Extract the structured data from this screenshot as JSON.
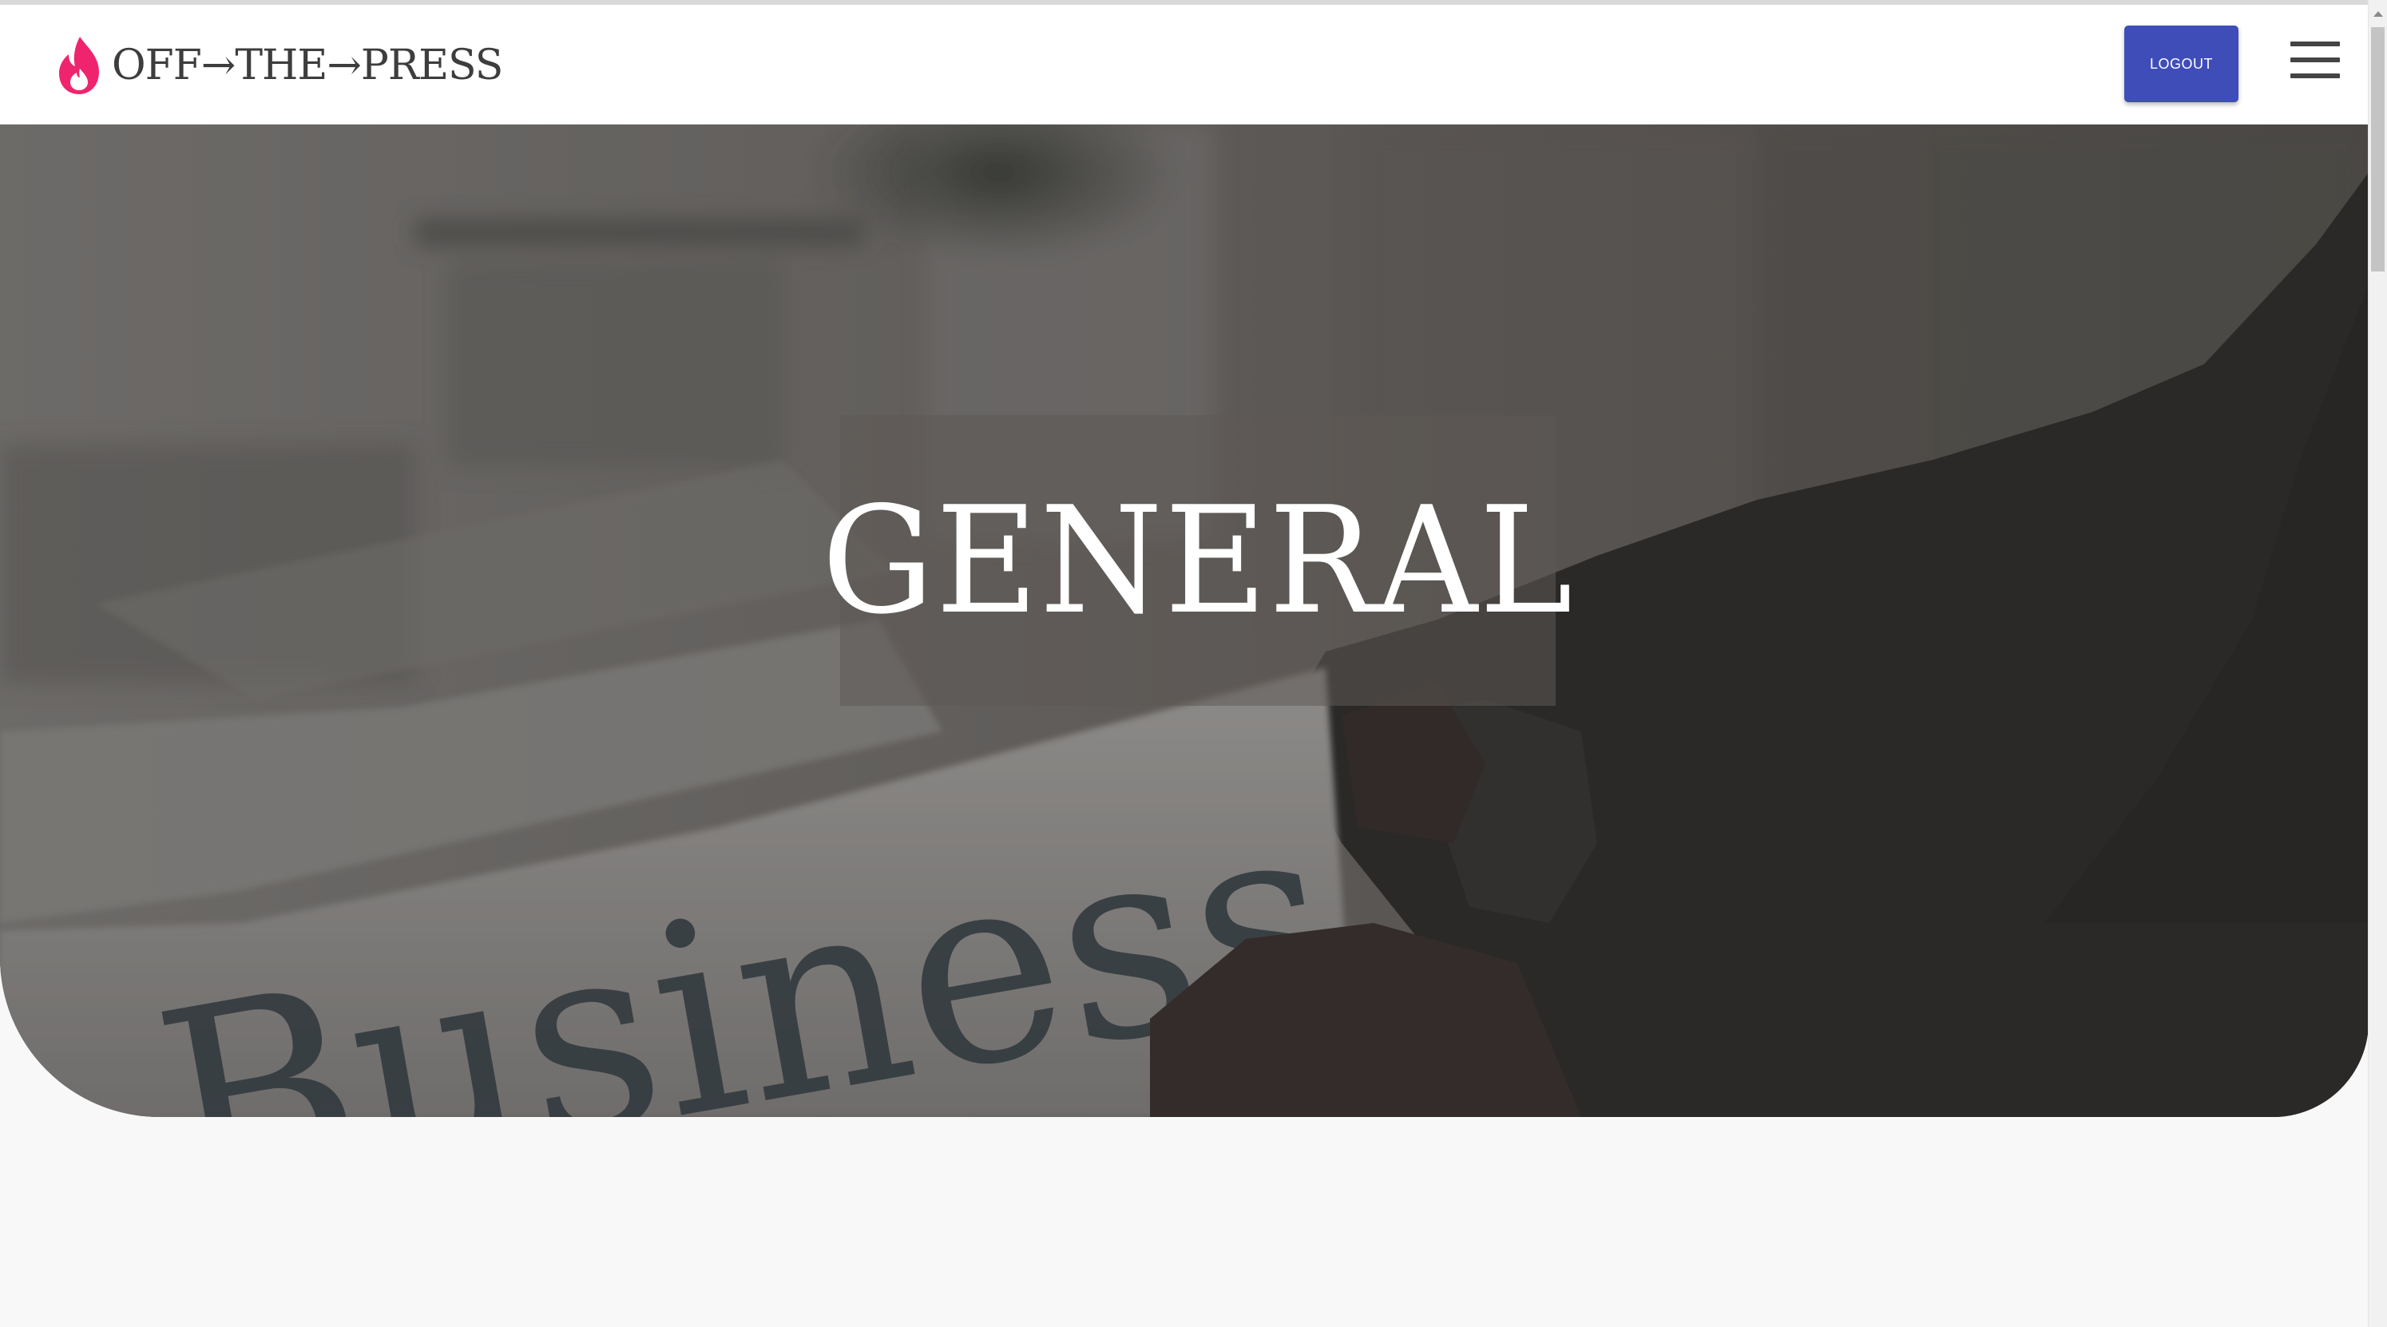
{
  "header": {
    "logo_text": "OFF→THE→PRESS",
    "logout_label": "LOGOUT",
    "logo_icon": "flame-icon",
    "menu_icon": "hamburger-menu-icon"
  },
  "hero": {
    "title": "GENERAL",
    "background_image": "newspaper-business-photo",
    "newspaper_headline": "Business"
  },
  "colors": {
    "brand_accent": "#f0246e",
    "logout_button": "#3f4db8",
    "header_background": "#ffffff",
    "page_background": "#f8f8f8"
  }
}
